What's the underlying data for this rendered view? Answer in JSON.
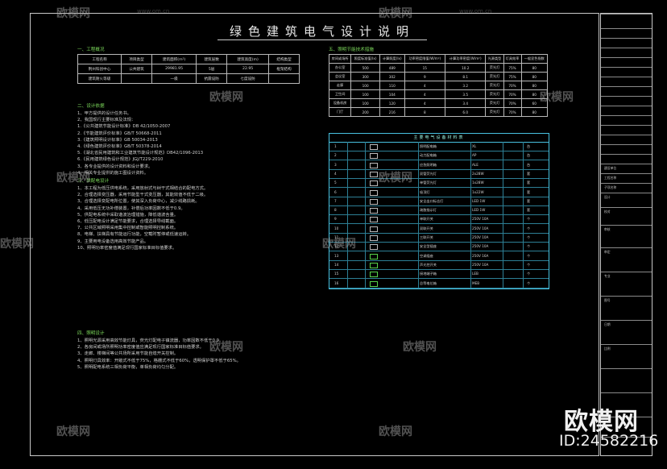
{
  "title": "绿色建筑电气设计说明",
  "left": {
    "s1": "一、工程概况",
    "t1_head": [
      "工程名称",
      "项目类型",
      "建筑面积(m²)",
      "建筑层数",
      "建筑高度(m)",
      "结构类型"
    ],
    "t1_rows": [
      [
        "荆州科创中心",
        "公共建筑",
        "29981.95",
        "5层",
        "22.95",
        "框架结构"
      ],
      [
        "建筑耐火等级",
        "",
        "一级",
        "抗震设防",
        "七度设防",
        ""
      ]
    ],
    "s2": "二、设计依据",
    "s2_lines": [
      "1、甲方提供的设计任务书。",
      "2、我国现行主要标准及法规：",
      "1.《公共建筑节能设计标准》DB 42/1050-2007",
      "2.《节能建筑评价标准》GB/T 50668-2011",
      "3.《建筑照明设计标准》GB 50034-2013",
      "4.《绿色建筑评价标准》GB/T 50378-2014",
      "5.《湖北省民用建筑和工业建筑节能设计规范》DB42/1096-2013",
      "6.《民用建筑绿色设计规范》JGJ/T229-2010",
      "3、各专业提供的设计资料和设计要求。",
      "4、相关专业提供的施工图设计资料。"
    ],
    "s3": "三、供配电设计",
    "s3_lines": [
      "1、本工程为低压供电系统，采用放射式与树干式相结合的配电方式。",
      "2、合理选择变压器，采用节能型干式变压器，其能效值不低于二级。",
      "3、合理选择变配电所位置，使其深入负荷中心，减少线路损耗。",
      "4、采用低压无功补偿装置，补偿后功率因数不低于0.9。",
      "5、供配电系统中采取谐波治理措施，降低谐波含量。",
      "6、低压配电设计满足节能要求，合理选择导线截面。",
      "7、公共区域照明采用集中控制或智能照明控制系统。",
      "8、电梯、扶梯具有节能运行功能，空载时暂停或低速运转。",
      "9、主要用电设备选用高效节能产品。",
      "10、照明功率密度值满足现行国家标准目标值要求。"
    ],
    "s4": "四、照明设计",
    "s4_lines": [
      "1、照明光源采用高效节能灯具，荧光灯配电子镇流器，功率因数不低于0.9。",
      "2、各房间或场所照明功率密度值应满足现行国家标准目标值要求。",
      "3、走廊、楼梯间等公共场所采用节能自熄开关控制。",
      "4、照明灯具效率：开敞式不低于75%，格栅式不低于60%，透明保护罩不低于65%。",
      "5、照明配电系统三相负荷平衡，单相负荷均匀分配。"
    ]
  },
  "right": {
    "s5": "五、照明节能技术措施",
    "t2_head": [
      "房间或场所",
      "照度标准值(lx)",
      "计算照度(lx)",
      "功率密度限值(W/m²)",
      "计算功率密度(W/m²)",
      "光源类型",
      "灯具效率",
      "一般显色指数"
    ],
    "t2_rows": [
      [
        "办公室",
        "500",
        "489",
        "15",
        "10.2",
        "荧光灯",
        "75%",
        "80"
      ],
      [
        "会议室",
        "300",
        "302",
        "9",
        "8.1",
        "荧光灯",
        "75%",
        "80"
      ],
      [
        "走廊",
        "100",
        "110",
        "4",
        "3.2",
        "荧光灯",
        "70%",
        "80"
      ],
      [
        "卫生间",
        "100",
        "104",
        "4",
        "3.5",
        "荧光灯",
        "70%",
        "80"
      ],
      [
        "设备机房",
        "100",
        "120",
        "4",
        "3.4",
        "荧光灯",
        "70%",
        "60"
      ],
      [
        "门厅",
        "200",
        "216",
        "8",
        "6.0",
        "荧光灯",
        "70%",
        "80"
      ]
    ],
    "legend_title": "主要电气设备材料表",
    "legend_rows": [
      [
        "1",
        "照明配电箱",
        "XL",
        "台"
      ],
      [
        "2",
        "动力配电箱",
        "AP",
        "台"
      ],
      [
        "3",
        "应急照明箱",
        "ALE",
        "台"
      ],
      [
        "4",
        "双管荧光灯",
        "2x28W",
        "套"
      ],
      [
        "5",
        "单管荧光灯",
        "1x28W",
        "套"
      ],
      [
        "6",
        "吸顶灯",
        "1x22W",
        "套"
      ],
      [
        "7",
        "安全出口标志灯",
        "LED 1W",
        "套"
      ],
      [
        "8",
        "疏散指示灯",
        "LED 1W",
        "套"
      ],
      [
        "9",
        "单联开关",
        "250V 10A",
        "个"
      ],
      [
        "10",
        "双联开关",
        "250V 10A",
        "个"
      ],
      [
        "11",
        "三联开关",
        "250V 10A",
        "个"
      ],
      [
        "12",
        "安全型插座",
        "250V 10A",
        "个"
      ],
      [
        "13",
        "空调插座",
        "250V 16A",
        "个"
      ],
      [
        "14",
        "声光控开关",
        "250V 10A",
        "个"
      ],
      [
        "15",
        "接地端子箱",
        "LEB",
        "个"
      ],
      [
        "16",
        "总等电位箱",
        "MEB",
        "个"
      ]
    ]
  },
  "titleblock": [
    "建设单位",
    "工程名称",
    "子项名称",
    "设计",
    "校对",
    "审核",
    "审定",
    "专业",
    "图号",
    "日期",
    "比例"
  ],
  "watermark": {
    "brand": "欧模网",
    "url": "www.om.cn",
    "id": "ID:24582216"
  }
}
